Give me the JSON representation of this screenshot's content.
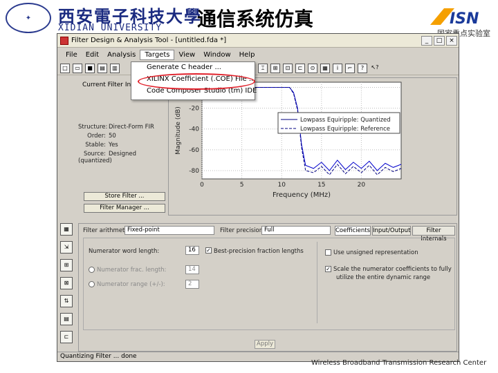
{
  "slide": {
    "school_cn": "西安電子科技大學",
    "school_en": "XIDIAN UNIVERSITY",
    "title": "通信系统仿真",
    "lab_logo": "ISN",
    "lab_name": "国家重点实验室",
    "footer": "Wireless Broadband Transmission Research Center"
  },
  "window": {
    "title": "Filter Design & Analysis Tool - [untitled.fda *]",
    "controls": [
      "_",
      "□",
      "×"
    ]
  },
  "menubar": [
    "File",
    "Edit",
    "Analysis",
    "Targets",
    "View",
    "Window",
    "Help"
  ],
  "active_menu": "Targets",
  "toolbar_icons": [
    "new-icon",
    "open-icon",
    "save-icon",
    "print-icon",
    "print-preview-icon",
    "zoom-icon",
    "magnitude-icon",
    "phase-icon",
    "magphase-icon",
    "groupdelay-icon",
    "impulse-icon",
    "step-icon",
    "polezero-icon",
    "coefficients-icon",
    "info-icon",
    "help-icon",
    "whats-this-icon"
  ],
  "dropdown": {
    "items": [
      "Generate C header ...",
      "XILINX Coefficient (.COE) File ...",
      "Code Composer Studio (tm) IDE"
    ]
  },
  "info_panel": {
    "title": "Current Filter Information",
    "rows": [
      {
        "label": "Structure:",
        "value": "Direct-Form FIR"
      },
      {
        "label": "Order:",
        "value": "50"
      },
      {
        "label": "Stable:",
        "value": "Yes"
      },
      {
        "label": "Source:",
        "value": "Designed (quantized)"
      }
    ],
    "store_button": "Store Filter ...",
    "manager_button": "Filter Manager ..."
  },
  "chart_data": {
    "type": "line",
    "xlabel": "Frequency (MHz)",
    "ylabel": "Magnitude (dB)",
    "xlim": [
      0,
      25
    ],
    "ylim": [
      -88,
      5
    ],
    "xticks": [
      0,
      5,
      10,
      15,
      20
    ],
    "yticks": [
      0,
      -20,
      -40,
      -60,
      -80
    ],
    "grid": true,
    "legend_position": "center-right",
    "series": [
      {
        "name": "Lowpass Equiripple: Quantized",
        "style": "solid",
        "x": [
          0,
          5,
          10,
          11,
          11.5,
          12,
          12.5,
          13,
          14,
          15,
          16,
          17,
          18,
          19,
          20,
          21,
          22,
          23,
          24,
          25
        ],
        "y": [
          0,
          0,
          0,
          0,
          -5,
          -20,
          -55,
          -75,
          -78,
          -72,
          -80,
          -70,
          -79,
          -72,
          -78,
          -71,
          -80,
          -73,
          -77,
          -74
        ]
      },
      {
        "name": "Lowpass Equiripple: Reference",
        "style": "dashed",
        "x": [
          0,
          5,
          10,
          11,
          11.5,
          12,
          12.5,
          13,
          14,
          15,
          16,
          17,
          18,
          19,
          20,
          21,
          22,
          23,
          24,
          25
        ],
        "y": [
          0,
          0,
          0,
          0,
          -6,
          -22,
          -58,
          -80,
          -82,
          -76,
          -84,
          -74,
          -83,
          -76,
          -82,
          -75,
          -84,
          -77,
          -81,
          -78
        ]
      }
    ]
  },
  "bottom_panel": {
    "filter_arithmetic_label": "Filter arithmetic:",
    "filter_arithmetic_value": "Fixed-point",
    "filter_precision_label": "Filter precision:",
    "filter_precision_value": "Full",
    "tabs": [
      "Coefficients",
      "Input/Output",
      "Filter Internals"
    ],
    "active_tab": "Coefficients",
    "numerator_word_length_label": "Numerator word length:",
    "numerator_word_length_value": "16",
    "best_precision_label": "Best-precision fraction lengths",
    "best_precision_checked": true,
    "numerator_frac_length_label": "Numerator frac. length:",
    "numerator_frac_length_value": "14",
    "numerator_range_label": "Numerator range (+/-):",
    "numerator_range_value": "2",
    "unsigned_label": "Use unsigned representation",
    "unsigned_checked": false,
    "scale_label_1": "Scale the numerator coefficients to fully",
    "scale_label_2": "utilize the entire dynamic range",
    "scale_checked": true,
    "apply": "Apply"
  },
  "left_strip_icons": [
    "design-filter-icon",
    "import-filter-icon",
    "transform-filter-icon",
    "realize-model-icon",
    "set-quantization-icon",
    "pole-zero-editor-icon",
    "multirate-icon"
  ],
  "status": "Quantizing Filter ... done",
  "colors": {
    "accent_red": "#e0202a",
    "plot_blue": "#0000cc",
    "window_bg": "#d4d0c8"
  }
}
